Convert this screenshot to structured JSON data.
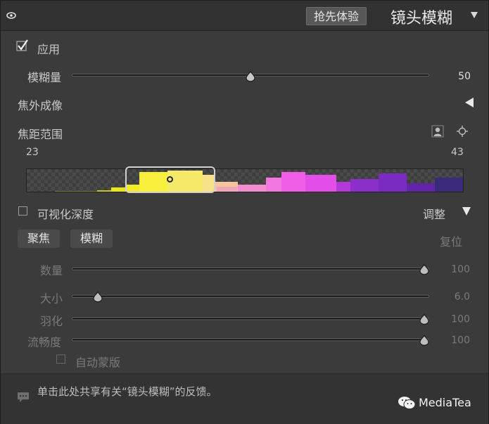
{
  "header": {
    "beta_label": "抢先体验",
    "title": "镜头模糊"
  },
  "apply": {
    "label": "应用",
    "checked": true
  },
  "blur_amount": {
    "label": "模糊量",
    "value": "50",
    "fraction": 0.5
  },
  "bokeh": {
    "label": "焦外成像"
  },
  "focal_range": {
    "label": "焦距范围",
    "min_label": "23",
    "max_label": "43"
  },
  "histogram": {
    "bins": [
      {
        "color": "#7a7a3a",
        "h": 1
      },
      {
        "color": "#c8c81a",
        "h": 2
      },
      {
        "color": "#e6e61a",
        "h": 6
      },
      {
        "color": "#f3ea2a",
        "h": 10
      },
      {
        "color": "#f8ee3c",
        "h": 28
      },
      {
        "color": "#f5e96a",
        "h": 30
      },
      {
        "color": "#f7e28a",
        "h": 24
      },
      {
        "color": "#f4c49c",
        "h": 14
      },
      {
        "color": "#f3a6b8",
        "h": 7
      },
      {
        "color": "#f28ed0",
        "h": 10
      },
      {
        "color": "#f278e0",
        "h": 20
      },
      {
        "color": "#f05ee8",
        "h": 28
      },
      {
        "color": "#e44ee8",
        "h": 24
      },
      {
        "color": "#b23ad8",
        "h": 14
      },
      {
        "color": "#8a30c8",
        "h": 18
      },
      {
        "color": "#7a2cc0",
        "h": 26
      },
      {
        "color": "#6224a8",
        "h": 12
      },
      {
        "color": "#3a2a7a",
        "h": 20
      }
    ]
  },
  "visualize_depth": {
    "label": "可视化深度",
    "checked": false
  },
  "adjust": {
    "label": "调整"
  },
  "tabs": {
    "focus_label": "聚焦",
    "blur_label": "模糊"
  },
  "reset": {
    "label": "复位"
  },
  "amount": {
    "label": "数量",
    "value": "100",
    "fraction": 1.0
  },
  "size": {
    "label": "大小",
    "value": "6.0",
    "fraction": 0.06
  },
  "feather": {
    "label": "羽化",
    "value": "100",
    "fraction": 1.0
  },
  "smoothness": {
    "label": "流畅度",
    "value": "100",
    "fraction": 1.0
  },
  "auto_mask": {
    "label": "自动蒙版",
    "checked": false
  },
  "footer": {
    "feedback": "单击此处共享有关“镜头模糊”的反馈。",
    "brand": "MediaTea"
  },
  "icons": {
    "eye": "eye-icon",
    "collapse": "triangle-down-icon",
    "bokeh": "triangle-left-icon",
    "subject": "person-icon",
    "target": "crosshair-icon",
    "speech": "speech-bubble-icon",
    "wechat": "wechat-icon"
  }
}
